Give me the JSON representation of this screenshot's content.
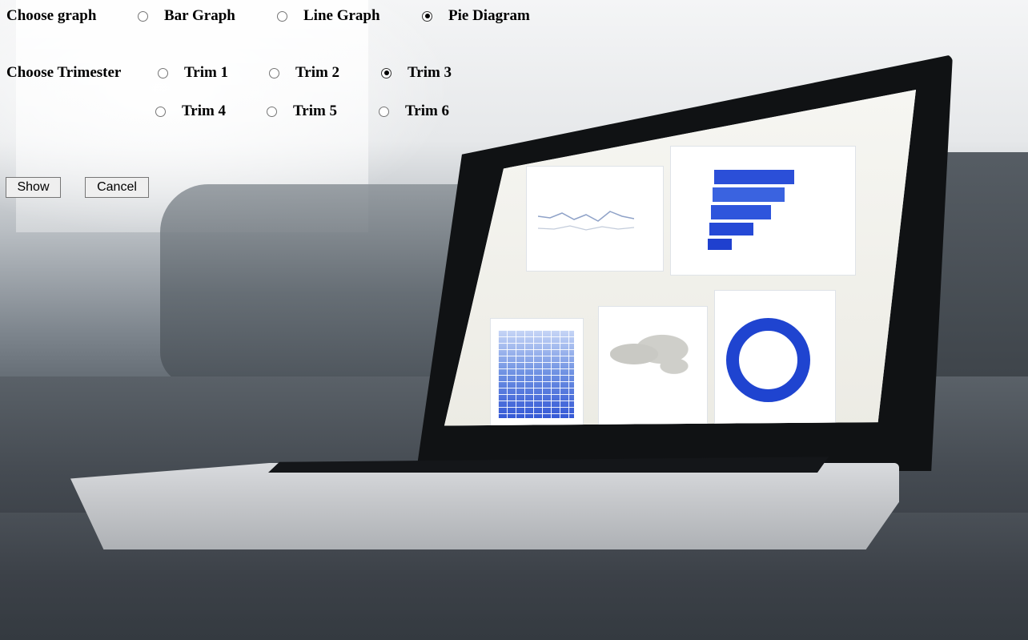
{
  "graph": {
    "label": "Choose graph",
    "options": [
      {
        "label": "Bar Graph",
        "checked": false
      },
      {
        "label": "Line Graph",
        "checked": false
      },
      {
        "label": "Pie Diagram",
        "checked": true
      }
    ]
  },
  "trimester": {
    "label": "Choose Trimester",
    "options": [
      {
        "label": "Trim 1",
        "checked": false
      },
      {
        "label": "Trim 2",
        "checked": false
      },
      {
        "label": "Trim 3",
        "checked": true
      },
      {
        "label": "Trim 4",
        "checked": false
      },
      {
        "label": "Trim 5",
        "checked": false
      },
      {
        "label": "Trim 6",
        "checked": false
      }
    ]
  },
  "buttons": {
    "show_label": "Show",
    "cancel_label": "Cancel"
  },
  "background": {
    "description_icon": "laptop-analytics-photo"
  }
}
